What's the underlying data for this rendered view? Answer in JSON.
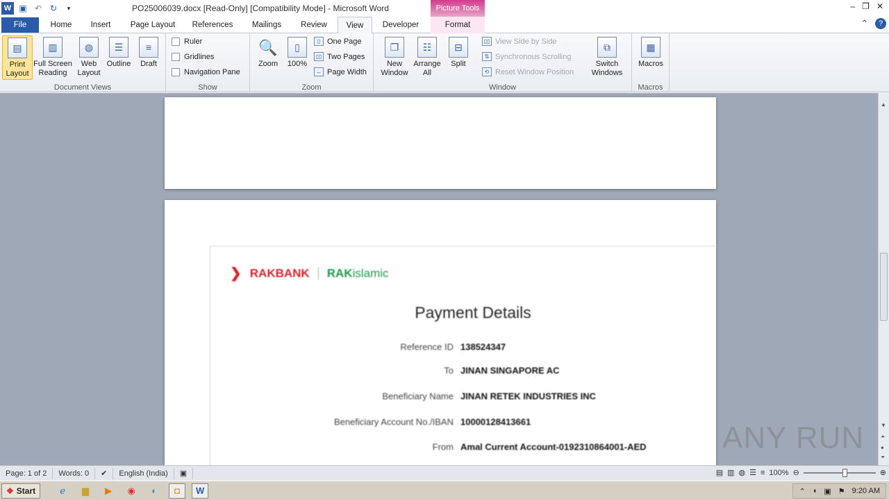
{
  "app": {
    "title": "PO25006039.docx [Read-Only] [Compatibility Mode]  -  Microsoft Word",
    "context_tab": "Picture Tools"
  },
  "qat": {
    "word_icon": "W",
    "save_icon": "save-icon",
    "undo_icon": "undo-icon",
    "redo_icon": "redo-icon"
  },
  "window_controls": {
    "minimize": "–",
    "restore": "❐",
    "close": "✕"
  },
  "tabs": [
    {
      "label": "File"
    },
    {
      "label": "Home"
    },
    {
      "label": "Insert"
    },
    {
      "label": "Page Layout"
    },
    {
      "label": "References"
    },
    {
      "label": "Mailings"
    },
    {
      "label": "Review"
    },
    {
      "label": "View"
    },
    {
      "label": "Developer"
    },
    {
      "label": "Format"
    }
  ],
  "ribbon": {
    "document_views": {
      "label": "Document Views",
      "print_layout": "Print Layout",
      "full_screen": "Full Screen Reading",
      "web_layout": "Web Layout",
      "outline": "Outline",
      "draft": "Draft"
    },
    "show": {
      "label": "Show",
      "ruler": "Ruler",
      "gridlines": "Gridlines",
      "nav_pane": "Navigation Pane"
    },
    "zoom": {
      "label": "Zoom",
      "zoom": "Zoom",
      "hundred": "100%",
      "one_page": "One Page",
      "two_pages": "Two Pages",
      "page_width": "Page Width"
    },
    "window": {
      "label": "Window",
      "new_window": "New Window",
      "arrange_all": "Arrange All",
      "split": "Split",
      "side_by_side": "View Side by Side",
      "sync_scroll": "Synchronous Scrolling",
      "reset_pos": "Reset Window Position",
      "switch_windows": "Switch Windows"
    },
    "macros": {
      "label": "Macros",
      "macros": "Macros"
    }
  },
  "document": {
    "logo_rak": "RAKBANK",
    "logo_islamic_bold": "RAK",
    "logo_islamic_light": "islamic",
    "title": "Payment Details",
    "rows": [
      {
        "label": "Reference ID",
        "value": "138524347"
      },
      {
        "label": "To",
        "value": "JINAN SINGAPORE AC"
      },
      {
        "label": "Beneficiary Name",
        "value": "JINAN RETEK INDUSTRIES INC"
      },
      {
        "label": "Beneficiary Account No./IBAN",
        "value": "10000128413661"
      },
      {
        "label": "From",
        "value": "Amal Current Account-0192310864001-AED"
      }
    ]
  },
  "watermark": "ANY RUN",
  "status": {
    "page": "Page: 1 of 2",
    "words": "Words: 0",
    "language": "English (India)",
    "zoom": "100%"
  },
  "taskbar": {
    "start": "Start",
    "time": "9:20 AM"
  }
}
